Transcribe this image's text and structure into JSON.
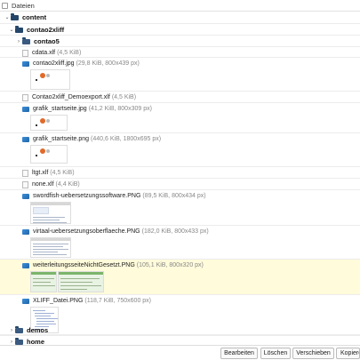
{
  "header": {
    "title": "Dateien"
  },
  "tree": {
    "root": "content",
    "contao2xliff": "contao2xliff",
    "contao5": "contao5",
    "files": [
      {
        "name": "cdata.xlf",
        "meta": "(4,5 KiB)"
      },
      {
        "name": "contao2xliff.jpg",
        "meta": "(29,8 KiB, 800x439 px)"
      },
      {
        "name": "Contao2xliff_Demoexport.xlf",
        "meta": "(4,5 KiB)"
      },
      {
        "name": "grafik_startseite.jpg",
        "meta": "(41,2 KiB, 800x309 px)"
      },
      {
        "name": "grafik_startseite.png",
        "meta": "(440,6 KiB, 1800x695 px)"
      },
      {
        "name": "ltgt.xlf",
        "meta": "(4,5 KiB)"
      },
      {
        "name": "none.xlf",
        "meta": "(4,4 KiB)"
      },
      {
        "name": "swordfish-uebersetzungssoftware.PNG",
        "meta": "(89,5 KiB, 800x434 px)"
      },
      {
        "name": "virtaal-uebersetzungsoberflaeche.PNG",
        "meta": "(182,0 KiB, 800x433 px)"
      },
      {
        "name": "weiterleitungsseiteNichtGesetzt.PNG",
        "meta": "(105,1 KiB, 800x320 px)"
      },
      {
        "name": "XLIFF_Datei.PNG",
        "meta": "(118,7 KiB, 750x600 px)"
      }
    ],
    "demos": "demos",
    "home": "home"
  },
  "footer": {
    "edit": "Bearbeiten",
    "delete": "Löschen",
    "move": "Verschieben",
    "copy": "Kopieren"
  }
}
